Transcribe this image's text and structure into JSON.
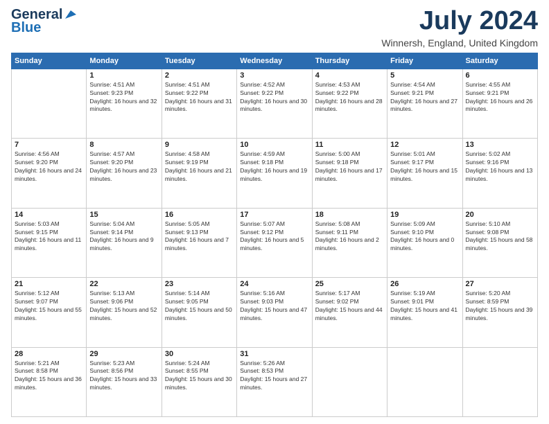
{
  "header": {
    "logo_line1": "General",
    "logo_line2": "Blue",
    "month_title": "July 2024",
    "location": "Winnersh, England, United Kingdom"
  },
  "days_of_week": [
    "Sunday",
    "Monday",
    "Tuesday",
    "Wednesday",
    "Thursday",
    "Friday",
    "Saturday"
  ],
  "weeks": [
    [
      {
        "day": "",
        "sunrise": "",
        "sunset": "",
        "daylight": ""
      },
      {
        "day": "1",
        "sunrise": "Sunrise: 4:51 AM",
        "sunset": "Sunset: 9:23 PM",
        "daylight": "Daylight: 16 hours and 32 minutes."
      },
      {
        "day": "2",
        "sunrise": "Sunrise: 4:51 AM",
        "sunset": "Sunset: 9:22 PM",
        "daylight": "Daylight: 16 hours and 31 minutes."
      },
      {
        "day": "3",
        "sunrise": "Sunrise: 4:52 AM",
        "sunset": "Sunset: 9:22 PM",
        "daylight": "Daylight: 16 hours and 30 minutes."
      },
      {
        "day": "4",
        "sunrise": "Sunrise: 4:53 AM",
        "sunset": "Sunset: 9:22 PM",
        "daylight": "Daylight: 16 hours and 28 minutes."
      },
      {
        "day": "5",
        "sunrise": "Sunrise: 4:54 AM",
        "sunset": "Sunset: 9:21 PM",
        "daylight": "Daylight: 16 hours and 27 minutes."
      },
      {
        "day": "6",
        "sunrise": "Sunrise: 4:55 AM",
        "sunset": "Sunset: 9:21 PM",
        "daylight": "Daylight: 16 hours and 26 minutes."
      }
    ],
    [
      {
        "day": "7",
        "sunrise": "Sunrise: 4:56 AM",
        "sunset": "Sunset: 9:20 PM",
        "daylight": "Daylight: 16 hours and 24 minutes."
      },
      {
        "day": "8",
        "sunrise": "Sunrise: 4:57 AM",
        "sunset": "Sunset: 9:20 PM",
        "daylight": "Daylight: 16 hours and 23 minutes."
      },
      {
        "day": "9",
        "sunrise": "Sunrise: 4:58 AM",
        "sunset": "Sunset: 9:19 PM",
        "daylight": "Daylight: 16 hours and 21 minutes."
      },
      {
        "day": "10",
        "sunrise": "Sunrise: 4:59 AM",
        "sunset": "Sunset: 9:18 PM",
        "daylight": "Daylight: 16 hours and 19 minutes."
      },
      {
        "day": "11",
        "sunrise": "Sunrise: 5:00 AM",
        "sunset": "Sunset: 9:18 PM",
        "daylight": "Daylight: 16 hours and 17 minutes."
      },
      {
        "day": "12",
        "sunrise": "Sunrise: 5:01 AM",
        "sunset": "Sunset: 9:17 PM",
        "daylight": "Daylight: 16 hours and 15 minutes."
      },
      {
        "day": "13",
        "sunrise": "Sunrise: 5:02 AM",
        "sunset": "Sunset: 9:16 PM",
        "daylight": "Daylight: 16 hours and 13 minutes."
      }
    ],
    [
      {
        "day": "14",
        "sunrise": "Sunrise: 5:03 AM",
        "sunset": "Sunset: 9:15 PM",
        "daylight": "Daylight: 16 hours and 11 minutes."
      },
      {
        "day": "15",
        "sunrise": "Sunrise: 5:04 AM",
        "sunset": "Sunset: 9:14 PM",
        "daylight": "Daylight: 16 hours and 9 minutes."
      },
      {
        "day": "16",
        "sunrise": "Sunrise: 5:05 AM",
        "sunset": "Sunset: 9:13 PM",
        "daylight": "Daylight: 16 hours and 7 minutes."
      },
      {
        "day": "17",
        "sunrise": "Sunrise: 5:07 AM",
        "sunset": "Sunset: 9:12 PM",
        "daylight": "Daylight: 16 hours and 5 minutes."
      },
      {
        "day": "18",
        "sunrise": "Sunrise: 5:08 AM",
        "sunset": "Sunset: 9:11 PM",
        "daylight": "Daylight: 16 hours and 2 minutes."
      },
      {
        "day": "19",
        "sunrise": "Sunrise: 5:09 AM",
        "sunset": "Sunset: 9:10 PM",
        "daylight": "Daylight: 16 hours and 0 minutes."
      },
      {
        "day": "20",
        "sunrise": "Sunrise: 5:10 AM",
        "sunset": "Sunset: 9:08 PM",
        "daylight": "Daylight: 15 hours and 58 minutes."
      }
    ],
    [
      {
        "day": "21",
        "sunrise": "Sunrise: 5:12 AM",
        "sunset": "Sunset: 9:07 PM",
        "daylight": "Daylight: 15 hours and 55 minutes."
      },
      {
        "day": "22",
        "sunrise": "Sunrise: 5:13 AM",
        "sunset": "Sunset: 9:06 PM",
        "daylight": "Daylight: 15 hours and 52 minutes."
      },
      {
        "day": "23",
        "sunrise": "Sunrise: 5:14 AM",
        "sunset": "Sunset: 9:05 PM",
        "daylight": "Daylight: 15 hours and 50 minutes."
      },
      {
        "day": "24",
        "sunrise": "Sunrise: 5:16 AM",
        "sunset": "Sunset: 9:03 PM",
        "daylight": "Daylight: 15 hours and 47 minutes."
      },
      {
        "day": "25",
        "sunrise": "Sunrise: 5:17 AM",
        "sunset": "Sunset: 9:02 PM",
        "daylight": "Daylight: 15 hours and 44 minutes."
      },
      {
        "day": "26",
        "sunrise": "Sunrise: 5:19 AM",
        "sunset": "Sunset: 9:01 PM",
        "daylight": "Daylight: 15 hours and 41 minutes."
      },
      {
        "day": "27",
        "sunrise": "Sunrise: 5:20 AM",
        "sunset": "Sunset: 8:59 PM",
        "daylight": "Daylight: 15 hours and 39 minutes."
      }
    ],
    [
      {
        "day": "28",
        "sunrise": "Sunrise: 5:21 AM",
        "sunset": "Sunset: 8:58 PM",
        "daylight": "Daylight: 15 hours and 36 minutes."
      },
      {
        "day": "29",
        "sunrise": "Sunrise: 5:23 AM",
        "sunset": "Sunset: 8:56 PM",
        "daylight": "Daylight: 15 hours and 33 minutes."
      },
      {
        "day": "30",
        "sunrise": "Sunrise: 5:24 AM",
        "sunset": "Sunset: 8:55 PM",
        "daylight": "Daylight: 15 hours and 30 minutes."
      },
      {
        "day": "31",
        "sunrise": "Sunrise: 5:26 AM",
        "sunset": "Sunset: 8:53 PM",
        "daylight": "Daylight: 15 hours and 27 minutes."
      },
      {
        "day": "",
        "sunrise": "",
        "sunset": "",
        "daylight": ""
      },
      {
        "day": "",
        "sunrise": "",
        "sunset": "",
        "daylight": ""
      },
      {
        "day": "",
        "sunrise": "",
        "sunset": "",
        "daylight": ""
      }
    ]
  ]
}
